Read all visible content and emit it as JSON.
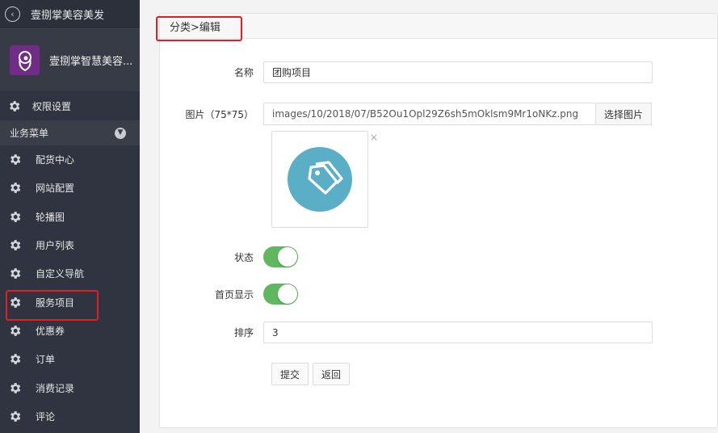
{
  "sidebar": {
    "top_title": "壹捌掌美容美发",
    "brand_name": "壹捌掌智慧美容...",
    "permission_label": "权限设置",
    "menu_header": "业务菜单",
    "items": [
      {
        "label": "配货中心"
      },
      {
        "label": "网站配置"
      },
      {
        "label": "轮播图"
      },
      {
        "label": "用户列表"
      },
      {
        "label": "自定义导航"
      },
      {
        "label": "服务项目"
      },
      {
        "label": "优惠券"
      },
      {
        "label": "订单"
      },
      {
        "label": "消费记录"
      },
      {
        "label": "评论"
      }
    ],
    "active_index": 5
  },
  "breadcrumb": "分类>编辑",
  "form": {
    "name_label": "名称",
    "name_value": "团购项目",
    "image_label": "图片（75*75）",
    "image_path": "images/10/2018/07/B52Ou1Opl29Z6sh5mOklsm9Mr1oNKz.png",
    "choose_image_label": "选择图片",
    "remove_image": "×",
    "status_label": "状态",
    "status_on": true,
    "home_label": "首页显示",
    "home_on": true,
    "order_label": "排序",
    "order_value": "3",
    "submit_label": "提交",
    "back_label": "返回"
  },
  "colors": {
    "sidebar_bg": "#2f3440",
    "toggle_on": "#5fb85f",
    "highlight": "#e02020",
    "tag_icon_bg": "#5aaec6",
    "brand_bg": "#6f2d83"
  }
}
